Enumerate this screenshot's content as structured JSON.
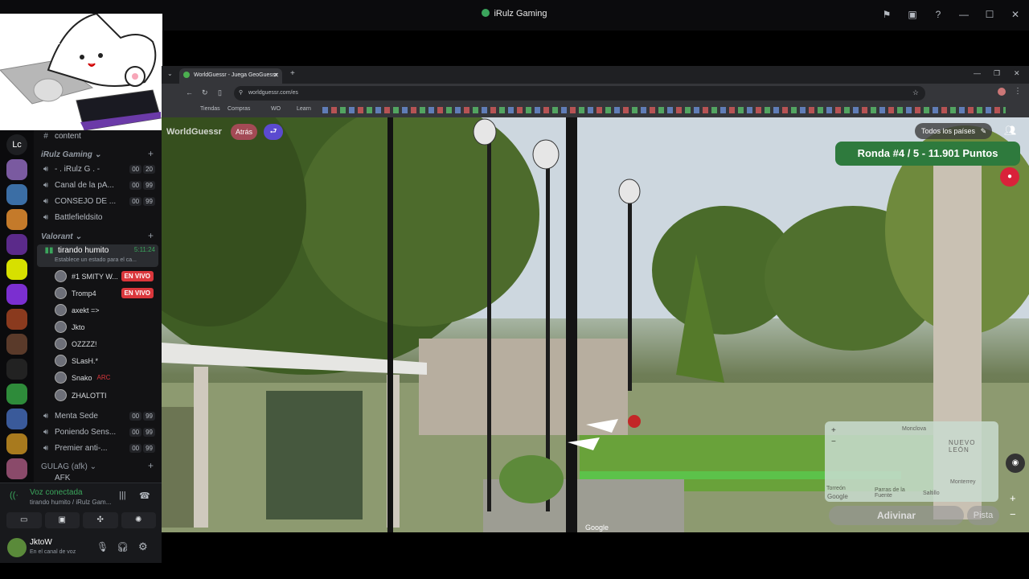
{
  "window": {
    "title": "iRulz Gaming"
  },
  "rail": {
    "lc_label": "Lc"
  },
  "channels": {
    "server_name": "iRulz",
    "top_item": "content",
    "cat1": "iRulz Gaming",
    "items1": [
      {
        "name": "- . iRulz G . -",
        "a": "00",
        "b": "20"
      },
      {
        "name": "Canal de la pA...",
        "a": "00",
        "b": "99"
      },
      {
        "name": "CONSEJO DE ...",
        "a": "00",
        "b": "99"
      },
      {
        "name": "Battlefieldsito",
        "a": "",
        "b": ""
      }
    ],
    "cat2": "Valorant",
    "active": {
      "name": "tirando humito",
      "time": "5:11:24",
      "status": "Establece un estado para el ca..."
    },
    "users": [
      {
        "name": "#1 SMITY W...",
        "live": "EN VIVO"
      },
      {
        "name": "Tromp4",
        "live": "EN VIVO"
      },
      {
        "name": "axekt =>",
        "live": ""
      },
      {
        "name": "Jkto",
        "live": ""
      },
      {
        "name": "OZZZZ!",
        "live": ""
      },
      {
        "name": "SLasH.*",
        "live": ""
      },
      {
        "name": "Snako",
        "live": "ARC"
      },
      {
        "name": "ZHALOTTI",
        "live": ""
      }
    ],
    "items2": [
      {
        "name": "Menta Sede",
        "a": "00",
        "b": "99"
      },
      {
        "name": "Poniendo Sens...",
        "a": "00",
        "b": "99"
      },
      {
        "name": "Premier anti-...",
        "a": "00",
        "b": "99"
      }
    ],
    "cat3": "GULAG (afk)",
    "cut_item": "AFK"
  },
  "voice": {
    "status": "Voz conectada",
    "detail": "tirando humito / iRulz Gam..."
  },
  "me": {
    "name": "JktoW",
    "status": "En el canal de voz"
  },
  "browser": {
    "tab_title": "WorldGuessr - Juega GeoGuessr",
    "url": "worldguessr.com/es",
    "bookmarks": [
      "Tiendas",
      "Compras",
      "WO",
      "Learn"
    ]
  },
  "game": {
    "logo": "WorldGuessr",
    "atras": "Atrás",
    "todos": "Todos los países",
    "ronda": "Ronda #4 / 5 - 11.901 Puntos",
    "map_labels": [
      "Monclova",
      "NUEVO LEÓN",
      "Monterrey",
      "Saltillo",
      "Torreón",
      "Parras de la Fuente",
      "Google"
    ],
    "adivinar": "Adivinar",
    "pista": "Pista",
    "google": "Google"
  }
}
